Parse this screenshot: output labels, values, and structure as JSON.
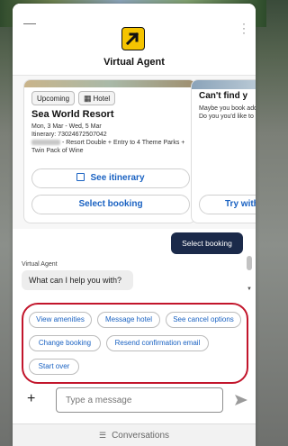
{
  "header": {
    "minimize_icon": "minus-icon",
    "title": "Virtual Agent",
    "logo_icon": "arrow-logo-icon",
    "brand_color": "#f5c400"
  },
  "cards": [
    {
      "tags": [
        "Upcoming",
        "Hotel"
      ],
      "title": "Sea World Resort",
      "dates": "Mon, 3 Mar - Wed, 5 Mar",
      "itinerary": "Itinerary: 73024672507042",
      "description": "- Resort Double + Entry to 4 Theme Parks + Twin Pack of Wine",
      "see_itinerary": "See itinerary",
      "select_booking": "Select booking"
    },
    {
      "title": "Can't find y",
      "description": "Maybe you book address. Do you you'd like to try?",
      "button": "Try with"
    }
  ],
  "chat": {
    "user_message": "Select booking",
    "agent_name": "Virtual Agent",
    "agent_message": "What can I help you with?"
  },
  "suggestions": [
    "View amenities",
    "Message hotel",
    "See cancel options",
    "Change booking",
    "Resend confirmation email",
    "Start over"
  ],
  "composer": {
    "placeholder": "Type a message"
  },
  "footer": {
    "label": "Conversations"
  },
  "colors": {
    "accent_blue": "#1a62c2",
    "user_bubble": "#1b2a4a",
    "highlight_red": "#c2152b"
  }
}
